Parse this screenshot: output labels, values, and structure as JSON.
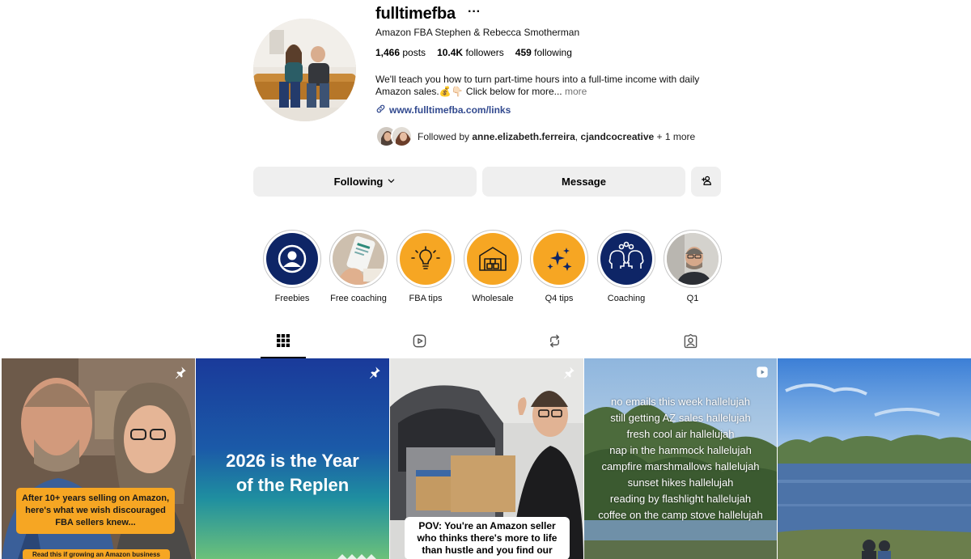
{
  "profile": {
    "username": "fulltimefba",
    "more_glyph": "···",
    "full_name": "Amazon FBA Stephen & Rebecca Smotherman",
    "stats": {
      "posts_count": "1,466",
      "posts_label": "posts",
      "followers_count": "10.4K",
      "followers_label": "followers",
      "following_count": "459",
      "following_label": "following"
    },
    "bio_line1": "We'll teach you how to turn part-time hours into a full-time income with daily",
    "bio_line2": "Amazon sales.💰👇🏻 Click below for more...",
    "bio_more": "more",
    "link_text": "www.fulltimefba.com/links",
    "followed_prefix": "Followed by",
    "followed_user1": "anne.elizabeth.ferreira",
    "followed_sep": ",",
    "followed_user2": "cjandcocreative",
    "followed_suffix": "+ 1 more"
  },
  "actions": {
    "following_label": "Following",
    "message_label": "Message"
  },
  "highlights": [
    {
      "label": "Freebies",
      "icon": "person-circle-icon"
    },
    {
      "label": "Free coaching",
      "icon": "phone-photo"
    },
    {
      "label": "FBA tips",
      "icon": "lightbulb-icon"
    },
    {
      "label": "Wholesale",
      "icon": "warehouse-icon"
    },
    {
      "label": "Q4 tips",
      "icon": "sparkles-icon"
    },
    {
      "label": "Coaching",
      "icon": "heads-gears-icon"
    },
    {
      "label": "Q1",
      "icon": "man-photo"
    }
  ],
  "tabs": [
    {
      "name": "posts",
      "icon": "grid-icon",
      "active": true
    },
    {
      "name": "reels",
      "icon": "reels-icon",
      "active": false
    },
    {
      "name": "reposts",
      "icon": "repost-icon",
      "active": false
    },
    {
      "name": "tagged",
      "icon": "tagged-icon",
      "active": false
    }
  ],
  "posts": [
    {
      "pinned": true,
      "caption": "After 10+ years selling on Amazon, here's what we wish discouraged FBA sellers knew...",
      "footer": "Read this if growing an Amazon business"
    },
    {
      "pinned": true,
      "title_line1": "2026 is the Year",
      "title_line2": "of the Replen"
    },
    {
      "pinned": true,
      "caption_line1": "POV: You're an Amazon seller",
      "caption_line2": "who thinks there's more to life",
      "caption_line3": "than hustle and you find our"
    },
    {
      "reel": true,
      "lines": [
        "no emails this week hallelujah",
        "still getting AZ sales hallelujah",
        "fresh cool air hallelujah",
        "nap in the hammock hallelujah",
        "campfire marshmallows hallelujah",
        "sunset hikes hallelujah",
        "reading by flashlight hallelujah",
        "coffee on the camp stove hallelujah"
      ]
    },
    {
      "scene": "lake"
    }
  ],
  "colors": {
    "orange": "#f6a623",
    "navy": "#0e2566",
    "link_blue": "#324a8f",
    "button_gray": "#efefef"
  }
}
